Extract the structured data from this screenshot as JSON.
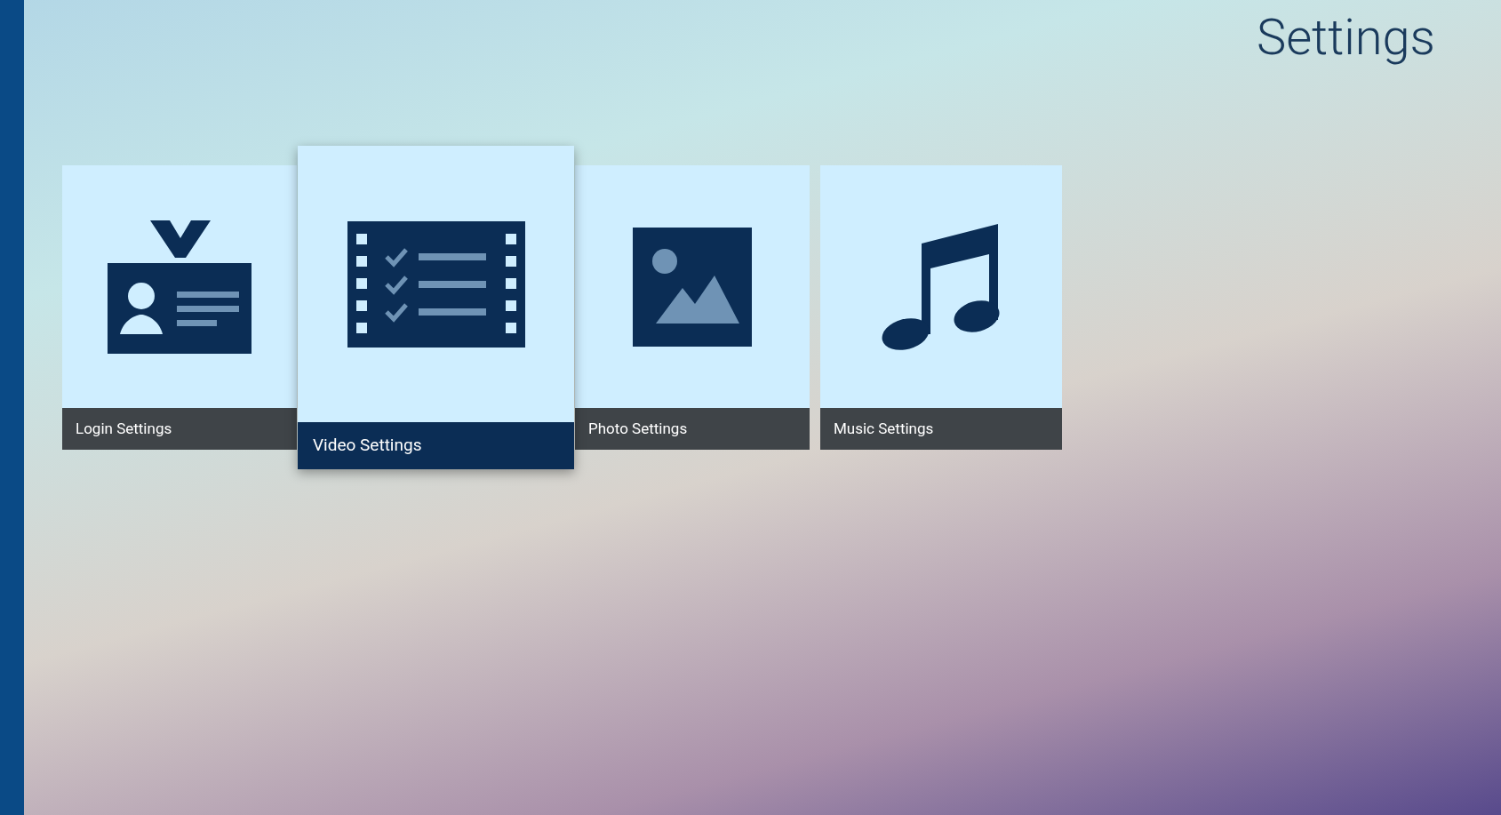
{
  "title": "Settings",
  "tiles": [
    {
      "label": "Login Settings",
      "kind": "id-card",
      "selected": false
    },
    {
      "label": "Video Settings",
      "kind": "film-checklist",
      "selected": true
    },
    {
      "label": "Photo Settings",
      "kind": "image",
      "selected": false
    },
    {
      "label": "Music Settings",
      "kind": "music-note",
      "selected": false
    }
  ]
}
